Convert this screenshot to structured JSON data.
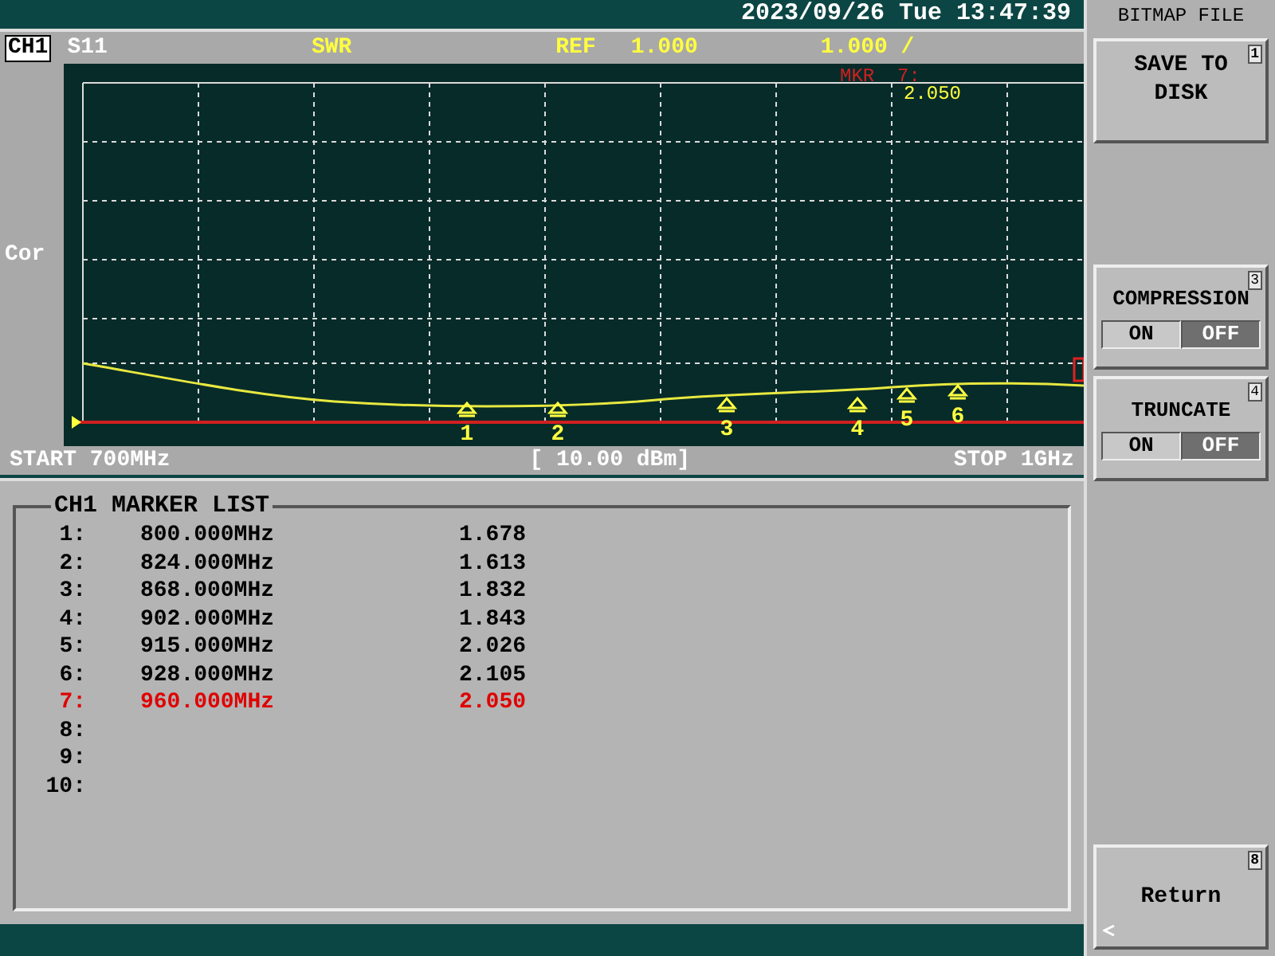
{
  "header": {
    "datetime": "2023/09/26 Tue 13:47:39"
  },
  "channel_bar": {
    "channel": "CH1",
    "parameter": "S11",
    "format": "SWR",
    "ref_label": "REF",
    "ref_value": "1.000",
    "scale": "1.000 /"
  },
  "plot": {
    "side_label": "Cor",
    "marker_readout_label": "MKR  7:",
    "marker_readout_value": "2.050",
    "markers": [
      {
        "label": "1"
      },
      {
        "label": "2"
      },
      {
        "label": "3"
      },
      {
        "label": "4"
      },
      {
        "label": "5"
      },
      {
        "label": "6"
      }
    ]
  },
  "footer": {
    "start": "START 700MHz",
    "power": "[ 10.00 dBm]",
    "stop": "STOP 1GHz"
  },
  "marker_list": {
    "title": "CH1 MARKER LIST",
    "rows": [
      {
        "index": "1:",
        "frequency": "800.000MHz",
        "value": "1.678",
        "active": false
      },
      {
        "index": "2:",
        "frequency": "824.000MHz",
        "value": "1.613",
        "active": false
      },
      {
        "index": "3:",
        "frequency": "868.000MHz",
        "value": "1.832",
        "active": false
      },
      {
        "index": "4:",
        "frequency": "902.000MHz",
        "value": "1.843",
        "active": false
      },
      {
        "index": "5:",
        "frequency": "915.000MHz",
        "value": "2.026",
        "active": false
      },
      {
        "index": "6:",
        "frequency": "928.000MHz",
        "value": "2.105",
        "active": false
      },
      {
        "index": "7:",
        "frequency": "960.000MHz",
        "value": "2.050",
        "active": true
      },
      {
        "index": "8:",
        "active": false
      },
      {
        "index": "9:",
        "active": false
      },
      {
        "index": "10:",
        "active": false
      }
    ]
  },
  "softkeys": {
    "title": "BITMAP FILE",
    "keys": [
      {
        "kind": "button",
        "label": "SAVE TO DISK",
        "number": "1"
      },
      {
        "kind": "toggle",
        "label": "COMPRESSION",
        "number": "3",
        "options": [
          {
            "label": "ON",
            "selected": false
          },
          {
            "label": "OFF",
            "selected": true
          }
        ]
      },
      {
        "kind": "toggle",
        "label": "TRUNCATE",
        "number": "4",
        "options": [
          {
            "label": "ON",
            "selected": false
          },
          {
            "label": "OFF",
            "selected": true
          }
        ]
      }
    ],
    "bottom_key": {
      "kind": "button",
      "label": "Return",
      "number": "8"
    }
  }
}
